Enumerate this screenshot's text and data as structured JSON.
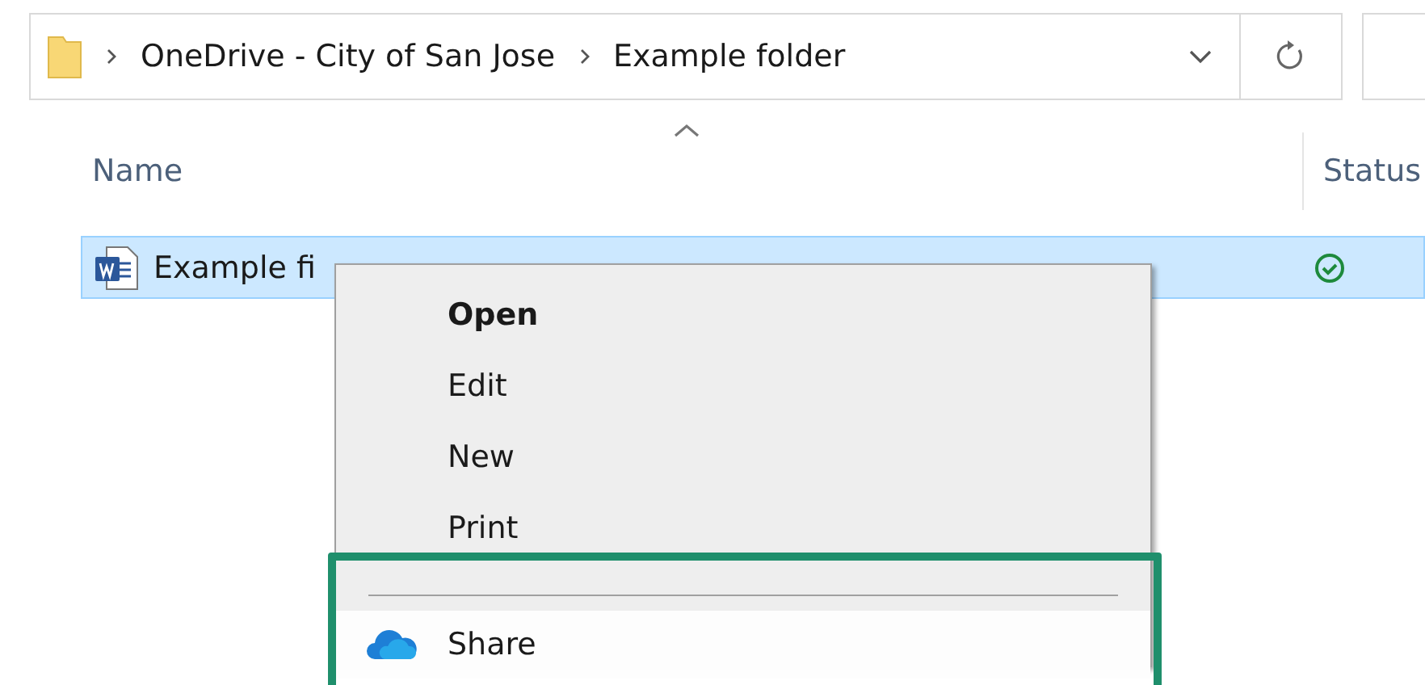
{
  "address_bar": {
    "breadcrumbs": [
      "OneDrive - City of San Jose",
      "Example folder"
    ]
  },
  "columns": [
    {
      "label": "Name",
      "sorted": true
    },
    {
      "label": "Status",
      "sorted": false
    }
  ],
  "rows": [
    {
      "name": "Example fi",
      "selected": true,
      "synced": true
    }
  ],
  "context_menu": {
    "items": [
      {
        "label": "Open",
        "kind": "plain",
        "default": true,
        "selected": false,
        "separator_before": false,
        "highlighted": false
      },
      {
        "label": "Edit",
        "kind": "plain",
        "default": false,
        "selected": false,
        "separator_before": false,
        "highlighted": false
      },
      {
        "label": "New",
        "kind": "plain",
        "default": false,
        "selected": false,
        "separator_before": false,
        "highlighted": false
      },
      {
        "label": "Print",
        "kind": "plain",
        "default": false,
        "selected": false,
        "separator_before": false,
        "highlighted": false
      },
      {
        "label": "Share",
        "kind": "cloud",
        "default": false,
        "selected": true,
        "separator_before": true,
        "highlighted": true
      }
    ]
  }
}
